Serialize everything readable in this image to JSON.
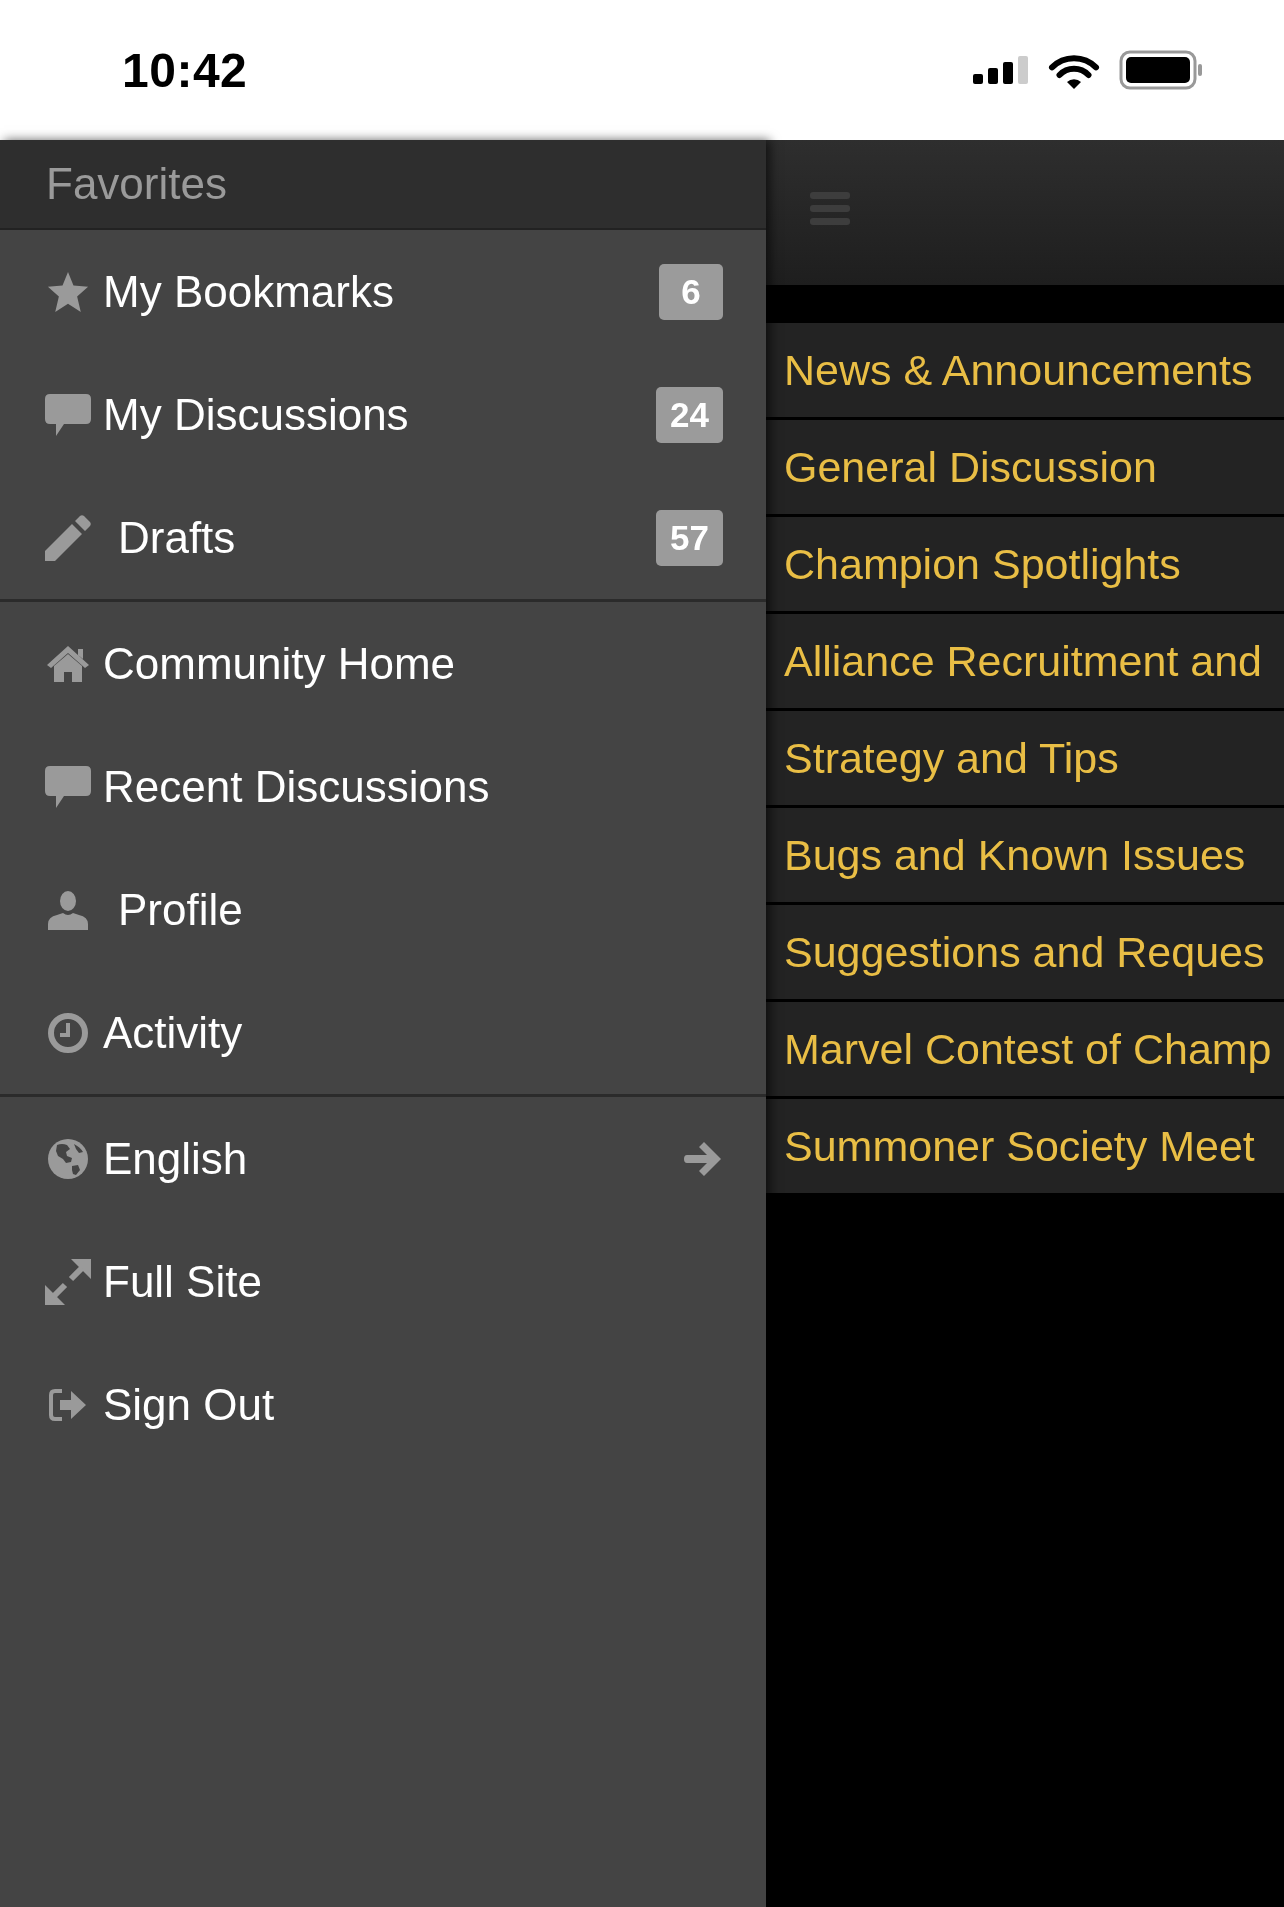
{
  "status_bar": {
    "time": "10:42"
  },
  "sidebar": {
    "header": "Favorites",
    "sections": [
      {
        "items": [
          {
            "label": "My Bookmarks",
            "badge": "6",
            "submenu": false
          },
          {
            "label": "My Discussions",
            "badge": "24",
            "submenu": false
          },
          {
            "label": "Drafts",
            "badge": "57",
            "submenu": false
          }
        ]
      },
      {
        "items": [
          {
            "label": "Community Home",
            "submenu": false
          },
          {
            "label": "Recent Discussions",
            "submenu": false
          },
          {
            "label": "Profile",
            "submenu": false
          },
          {
            "label": "Activity",
            "submenu": false
          }
        ]
      },
      {
        "items": [
          {
            "label": "English",
            "submenu": true
          },
          {
            "label": "Full Site",
            "submenu": false
          },
          {
            "label": "Sign Out",
            "submenu": false
          }
        ]
      }
    ]
  },
  "content": {
    "categories": [
      "News & Announcements",
      "General Discussion",
      "Champion Spotlights",
      "Alliance Recruitment and",
      "Strategy and Tips",
      "Bugs and Known Issues",
      "Suggestions and Reques",
      "Marvel Contest of Champ",
      "Summoner Society Meet"
    ]
  }
}
